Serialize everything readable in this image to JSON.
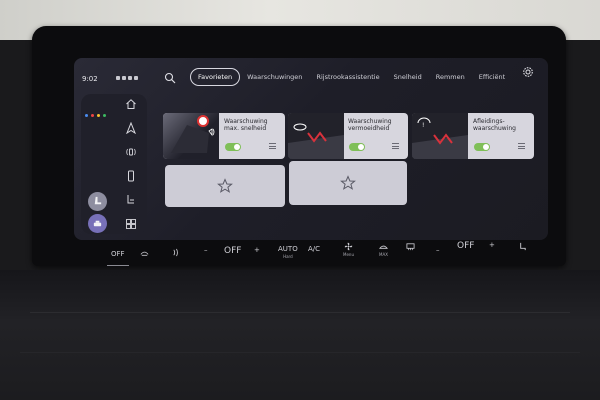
{
  "status": {
    "time": "9:02"
  },
  "colors": {
    "accent_toggle": "#7fbf58",
    "card_bg": "#d7d6de",
    "screen_bg": "#1e1e28"
  },
  "tabs": [
    {
      "label": "Favorieten",
      "active": true
    },
    {
      "label": "Waarschuwingen"
    },
    {
      "label": "Rijstrookassistentie"
    },
    {
      "label": "Snelheid"
    },
    {
      "label": "Remmen"
    },
    {
      "label": "Efficiënt"
    }
  ],
  "left_icons": [
    "home-icon",
    "navigation-icon",
    "phone-signal-icon",
    "phone-icon",
    "seat-icon",
    "grid-icon"
  ],
  "cards": [
    {
      "title": "Waarschuwing max. snelheid",
      "toggle": "on"
    },
    {
      "title": "Waarschuwing vermoeidheid",
      "toggle": "on"
    },
    {
      "title": "Afleidings-waarschuwing",
      "toggle": "on"
    }
  ],
  "climate": {
    "left_off": "OFF",
    "temp_left": "OFF",
    "auto": "AUTO",
    "auto_sub": "Hard",
    "ac": "A/C",
    "fan_sub": "Menu",
    "max_sub": "MAX",
    "temp_right": "OFF",
    "minus": "–",
    "plus": "+"
  }
}
